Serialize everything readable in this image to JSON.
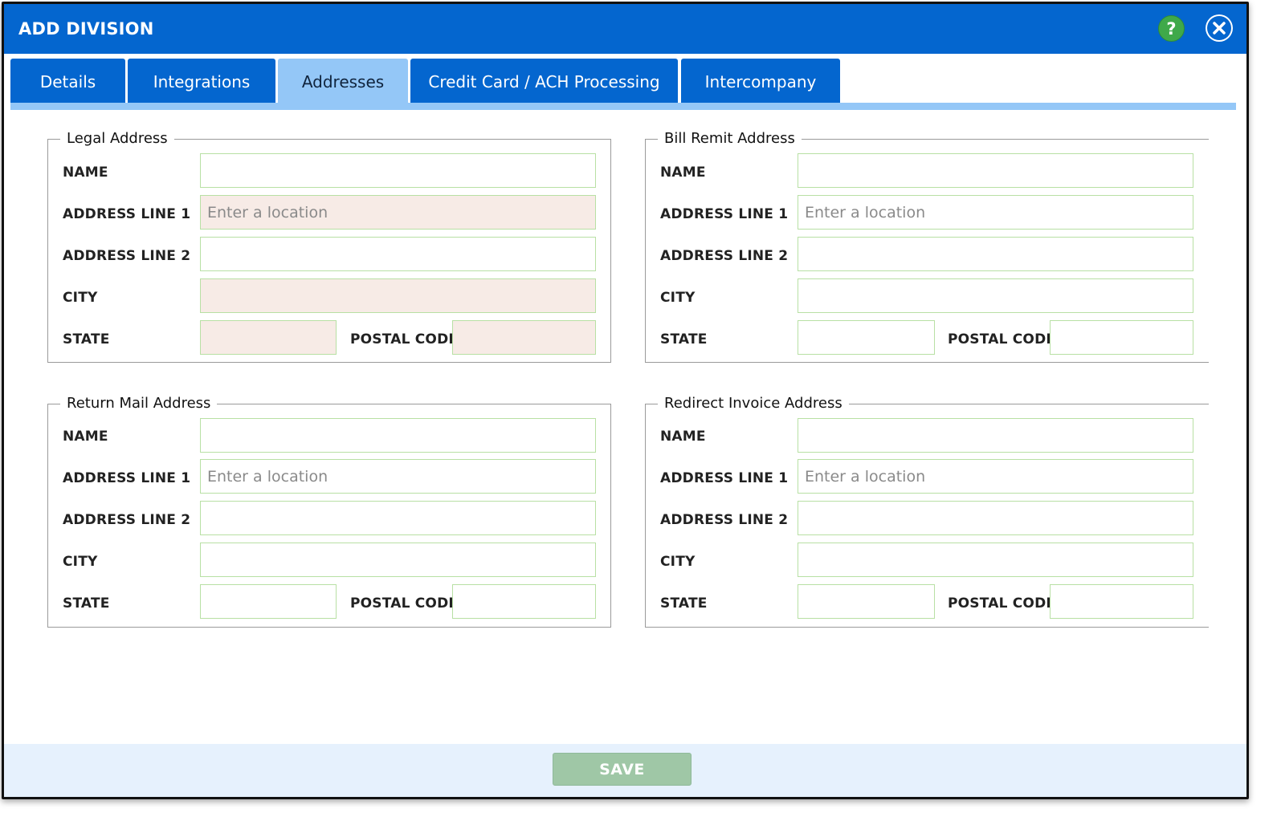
{
  "dialog": {
    "title": "ADD DIVISION",
    "help_icon_glyph": "?",
    "close_icon": "close-icon"
  },
  "tabs": [
    {
      "label": "Details",
      "active": false
    },
    {
      "label": "Integrations",
      "active": false
    },
    {
      "label": "Addresses",
      "active": true
    },
    {
      "label": "Credit Card / ACH Processing",
      "active": false
    },
    {
      "label": "Intercompany",
      "active": false
    }
  ],
  "labels": {
    "name": "NAME",
    "address_line_1": "ADDRESS LINE 1",
    "address_line_2": "ADDRESS LINE 2",
    "city": "CITY",
    "state": "STATE",
    "postal_code": "POSTAL CODE"
  },
  "sections": {
    "legal": {
      "title": "Legal Address",
      "name": "",
      "address_line_1": "",
      "address_line_1_placeholder": "Enter a location",
      "address_line_2": "",
      "city": "",
      "state": "",
      "postal_code": ""
    },
    "bill_remit": {
      "title": "Bill Remit Address",
      "name": "",
      "address_line_1": "",
      "address_line_1_placeholder": "Enter a location",
      "address_line_2": "",
      "city": "",
      "state": "",
      "postal_code": ""
    },
    "return_mail": {
      "title": "Return Mail Address",
      "name": "",
      "address_line_1": "",
      "address_line_1_placeholder": "Enter a location",
      "address_line_2": "",
      "city": "",
      "state": "",
      "postal_code": ""
    },
    "redirect_invoice": {
      "title": "Redirect Invoice Address",
      "name": "",
      "address_line_1": "",
      "address_line_1_placeholder": "Enter a location",
      "address_line_2": "",
      "city": "",
      "state": "",
      "postal_code": ""
    }
  },
  "footer": {
    "save_label": "SAVE"
  },
  "colors": {
    "header_blue": "#0466cf",
    "active_tab": "#94c7f7",
    "required_field": "#f7ebe6",
    "field_border": "#b8e0a4",
    "save_disabled": "#9fc7a6",
    "help_green": "#3fa94a"
  }
}
